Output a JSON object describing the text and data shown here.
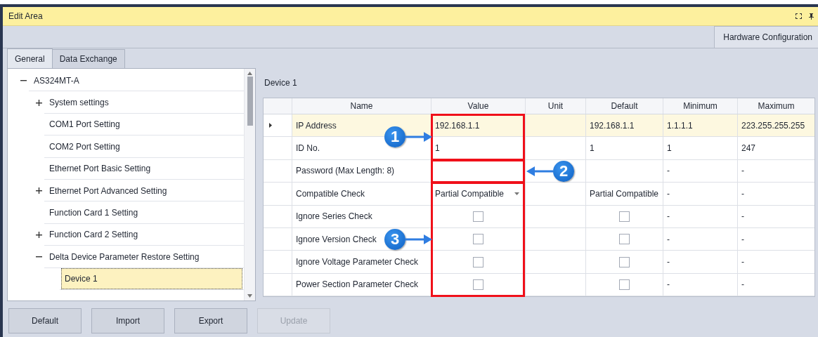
{
  "top_bar": {
    "title": "Edit Area"
  },
  "document_tabs": [
    {
      "label": "Hardware Configuration",
      "selected": true
    }
  ],
  "tabs": [
    {
      "label": "General",
      "selected": true
    },
    {
      "label": "Data Exchange",
      "selected": false
    }
  ],
  "tree": [
    {
      "label": "AS324MT-A",
      "kind": "node",
      "expanded": true,
      "selected": false,
      "children": [
        {
          "label": "System settings",
          "kind": "node",
          "expanded": false,
          "selected": false
        },
        {
          "label": "COM1 Port Setting",
          "kind": "leaf",
          "selected": false
        },
        {
          "label": "COM2 Port Setting",
          "kind": "leaf",
          "selected": false
        },
        {
          "label": "Ethernet Port Basic Setting",
          "kind": "leaf",
          "selected": false
        },
        {
          "label": "Ethernet Port Advanced Setting",
          "kind": "node",
          "expanded": false,
          "selected": false
        },
        {
          "label": "Function Card 1 Setting",
          "kind": "leaf",
          "selected": false
        },
        {
          "label": "Function Card 2 Setting",
          "kind": "node",
          "expanded": false,
          "selected": false
        },
        {
          "label": "Delta Device Parameter Restore Setting",
          "kind": "node",
          "expanded": true,
          "selected": false,
          "children": [
            {
              "label": "Device 1",
              "kind": "leaf",
              "selected": true
            }
          ]
        }
      ]
    }
  ],
  "panel_title": "Device 1",
  "table": {
    "columns": [
      "Name",
      "Value",
      "Unit",
      "Default",
      "Minimum",
      "Maximum"
    ],
    "groups": [
      {
        "callout": {
          "label": "1",
          "points_left": false
        },
        "rows": [
          {
            "name": "IP Address",
            "selected": true,
            "value": {
              "kind": "text",
              "text": "192.168.1.1"
            },
            "default": {
              "kind": "text",
              "text": "192.168.1.1"
            },
            "minimum": "1.1.1.1",
            "maximum": "223.255.255.255"
          },
          {
            "name": "ID No.",
            "selected": false,
            "value": {
              "kind": "text",
              "text": "1"
            },
            "default": {
              "kind": "text",
              "text": "1"
            },
            "minimum": "1",
            "maximum": "247"
          }
        ]
      },
      {
        "callout": {
          "label": "2",
          "points_left": true
        },
        "rows": [
          {
            "name": "Password (Max Length: 8)",
            "selected": false,
            "value": {
              "kind": "input"
            },
            "minimum": "-",
            "maximum": "-"
          }
        ]
      },
      {
        "callout": {
          "label": "3",
          "points_left": false
        },
        "rows": [
          {
            "name": "Compatible Check",
            "selected": false,
            "value": {
              "kind": "dropdown",
              "text": "Partial Compatible"
            },
            "default": {
              "kind": "text",
              "text": "Partial Compatible"
            },
            "minimum": "-",
            "maximum": "-"
          },
          {
            "name": "Ignore Series Check",
            "selected": false,
            "value": {
              "kind": "checkbox",
              "checked": false
            },
            "default": {
              "kind": "checkbox",
              "checked": false
            },
            "minimum": "-",
            "maximum": "-"
          },
          {
            "name": "Ignore Version Check",
            "selected": false,
            "value": {
              "kind": "checkbox",
              "checked": false
            },
            "default": {
              "kind": "checkbox",
              "checked": false
            },
            "minimum": "-",
            "maximum": "-"
          },
          {
            "name": "Ignore Voltage Parameter Check",
            "selected": false,
            "value": {
              "kind": "checkbox",
              "checked": false
            },
            "default": {
              "kind": "checkbox",
              "checked": false
            },
            "minimum": "-",
            "maximum": "-"
          },
          {
            "name": "Power Section Parameter Check",
            "selected": false,
            "value": {
              "kind": "checkbox",
              "checked": false
            },
            "default": {
              "kind": "checkbox",
              "checked": false
            },
            "minimum": "-",
            "maximum": "-"
          }
        ]
      }
    ]
  },
  "buttons": [
    {
      "label": "Default",
      "disabled": false
    },
    {
      "label": "Import",
      "disabled": false
    },
    {
      "label": "Export",
      "disabled": false
    },
    {
      "label": "Update",
      "disabled": true
    }
  ]
}
